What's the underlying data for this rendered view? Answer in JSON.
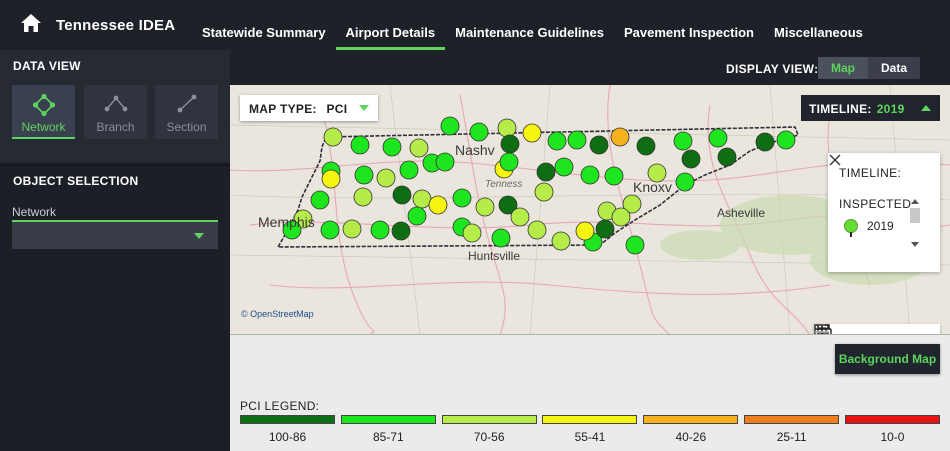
{
  "app": {
    "title": "Tennessee IDEA",
    "home_icon": "home-icon"
  },
  "nav": {
    "tabs": [
      {
        "label": "Statewide Summary",
        "active": false
      },
      {
        "label": "Airport Details",
        "active": true
      },
      {
        "label": "Maintenance Guidelines",
        "active": false
      },
      {
        "label": "Pavement Inspection",
        "active": false
      },
      {
        "label": "Miscellaneous",
        "active": false
      }
    ]
  },
  "data_view": {
    "title": "DATA VIEW",
    "buttons": [
      {
        "label": "Network",
        "icon": "network-icon",
        "active": true
      },
      {
        "label": "Branch",
        "icon": "branch-icon",
        "active": false
      },
      {
        "label": "Section",
        "icon": "section-icon",
        "active": false
      }
    ]
  },
  "object_selection": {
    "title": "OBJECT SELECTION",
    "field_label": "Network",
    "selected_value": ""
  },
  "display_view": {
    "label": "DISPLAY VIEW:",
    "options": [
      {
        "label": "Map",
        "active": true
      },
      {
        "label": "Data",
        "active": false
      }
    ]
  },
  "map": {
    "map_type_label": "MAP TYPE:",
    "map_type_value": "PCI",
    "timeline_label": "TIMELINE:",
    "timeline_year": "2019",
    "attribution": "© OpenStreetMap",
    "places": {
      "nashville": "Nashv",
      "tennessee": "Tenness",
      "knoxville": "Knoxv",
      "asheville": "Asheville",
      "memphis": "Memphis",
      "huntsville": "Huntsville"
    },
    "tools": [
      "fullscreen-icon",
      "print-icon",
      "zoom-in-icon",
      "zoom-out-icon"
    ]
  },
  "timeline_panel": {
    "title": "TIMELINE:",
    "inspected_label": "INSPECTED",
    "years": [
      "2019"
    ]
  },
  "background_map_button": "Background Map",
  "legend": {
    "title": "PCI LEGEND:",
    "items": [
      {
        "label": "100-86",
        "color": "#0f6e14"
      },
      {
        "label": "85-71",
        "color": "#1ee61e"
      },
      {
        "label": "70-56",
        "color": "#b6ec4a"
      },
      {
        "label": "55-41",
        "color": "#f5f511"
      },
      {
        "label": "40-26",
        "color": "#f5b21e"
      },
      {
        "label": "25-11",
        "color": "#f07d1e"
      },
      {
        "label": "10-0",
        "color": "#e81414"
      }
    ]
  },
  "colors": {
    "accent": "#5fd35f",
    "bg_dark": "#1e2128"
  }
}
